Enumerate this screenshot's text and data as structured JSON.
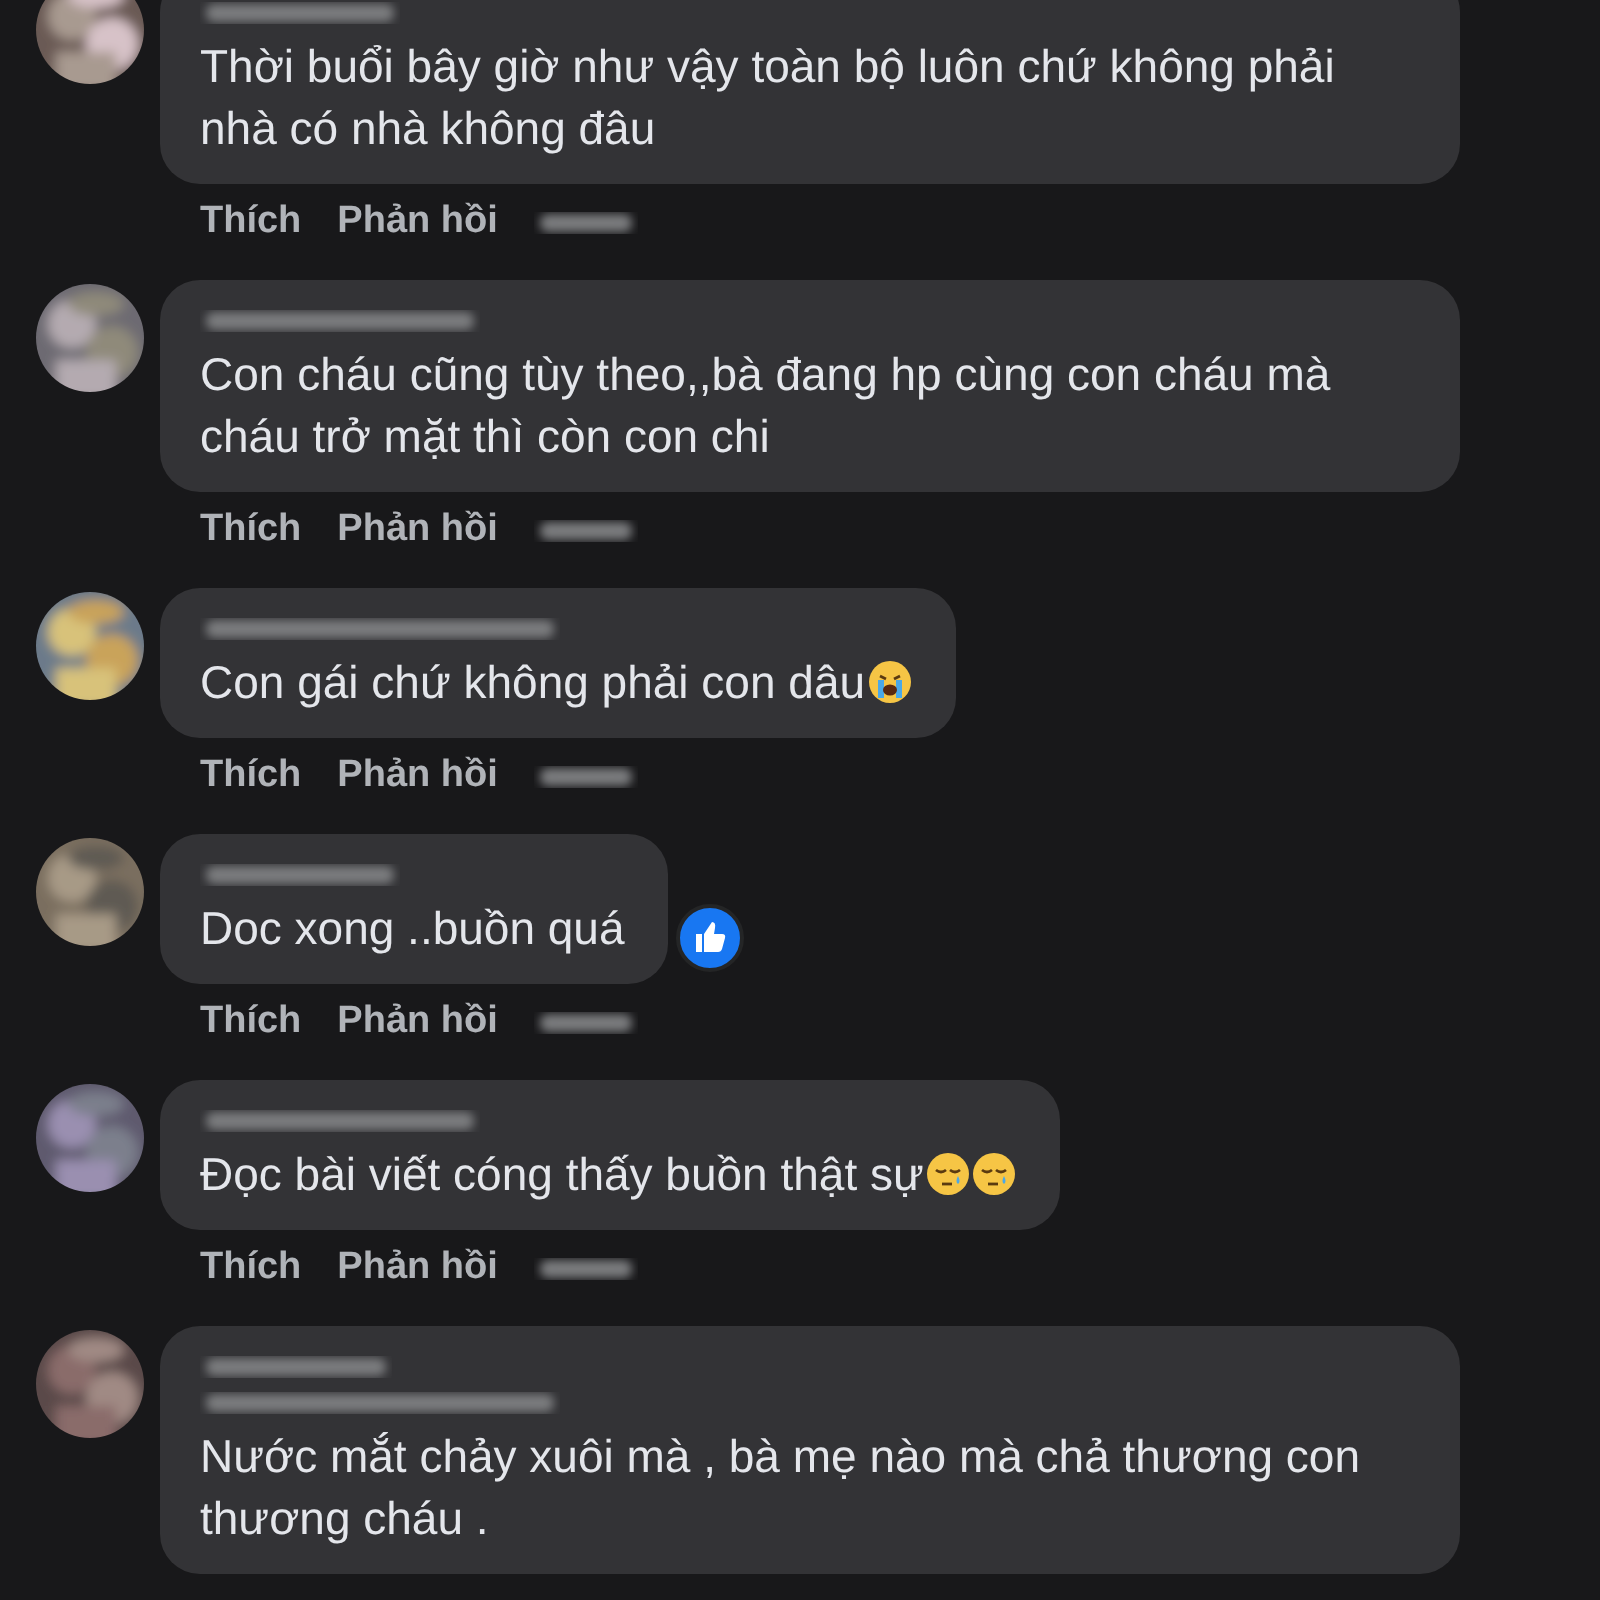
{
  "comments": [
    {
      "text": "Thời buổi bây giờ như vậy toàn bộ luôn chứ không phải nhà có nhà không đâu",
      "badge": false,
      "liked": false,
      "actions": [
        "Thích",
        "Phản hồi"
      ]
    },
    {
      "text": "Con cháu cũng tùy theo,,bà đang hp cùng con cháu mà cháu trở mặt thì còn con chi",
      "badge": false,
      "liked": false,
      "actions": [
        "Thích",
        "Phản hồi"
      ]
    },
    {
      "text": "Con gái chứ không phải con dâu",
      "badge": false,
      "icons": [
        {
          "kind": "crying"
        }
      ],
      "liked": false,
      "actions": [
        "Thích",
        "Phản hồi"
      ]
    },
    {
      "text": "Doc xong ..buồn quá",
      "badge": false,
      "liked": true,
      "actions": [
        "Thích",
        "Phản hồi"
      ]
    },
    {
      "text": "Đọc bài viết cóng thấy buồn thật sự",
      "badge": false,
      "icons": [
        {
          "kind": "sleepy"
        },
        {
          "kind": "sleepy"
        }
      ],
      "liked": false,
      "actions": [
        "Thích",
        "Phản hồi"
      ]
    },
    {
      "text": "Nước mắt chảy xuôi mà , bà mẹ nào mà chả thương con thương cháu .",
      "badge": true,
      "liked": false
    }
  ]
}
